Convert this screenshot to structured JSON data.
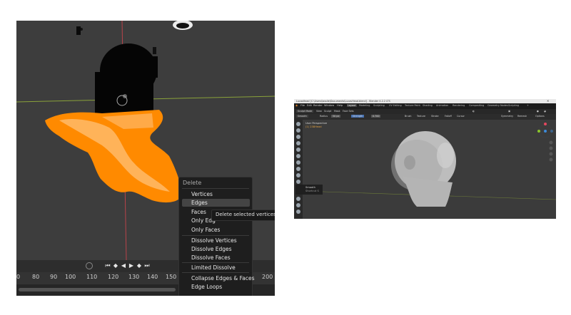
{
  "left_viewport": {
    "timeline_frames": [
      "0",
      "80",
      "90",
      "100",
      "110",
      "120",
      "130",
      "140",
      "150",
      "200"
    ],
    "context_menu": {
      "title": "Delete",
      "items": [
        "Vertices",
        "Edges",
        "Faces",
        "Only Edg",
        "Only Faces",
        "Dissolve Vertices",
        "Dissolve Edges",
        "Dissolve Faces",
        "Limited Dissolve",
        "Collapse Edges & Faces",
        "Edge Loops"
      ],
      "highlighted": "Edges"
    },
    "tooltip": "Delete selected vertices, ec",
    "colors": {
      "selection": "#ff8a00",
      "viewport_bg": "#3d3d3d",
      "menu_bg": "#1e1e1e"
    }
  },
  "right_window": {
    "title": "LucasHead [C:\\Users\\lassile\\Documents\\LucasHead.blend] - Blender 4.2.2 LTS",
    "menus": [
      "File",
      "Edit",
      "Render",
      "Window",
      "Help"
    ],
    "workspaces": [
      "Layout",
      "Modeling",
      "Sculpting",
      "UV Editing",
      "Texture Paint",
      "Shading",
      "Animation",
      "Rendering",
      "Compositing",
      "Geometry Nodes",
      "Scripting"
    ],
    "header": {
      "mode": "Sculpt Mode",
      "view": "View",
      "sculpt": "Sculpt",
      "mask": "Mask",
      "face_sets": "Face Sets"
    },
    "tool_settings": {
      "brush": "Smooth",
      "radius_label": "Radius",
      "radius_value": "50 px",
      "strength_label": "Strength",
      "strength_value": "0.700",
      "brush_menu": "Brush",
      "texture_menu": "Texture",
      "stroke_menu": "Stroke",
      "falloff_menu": "Falloff",
      "cursor_menu": "Cursor"
    },
    "overlay_text": {
      "view_name": "User Perspective",
      "object_name": "(1) 238Head"
    },
    "right_header": {
      "orientation": "Default",
      "symmetry_label": "Symmetry",
      "remesh": "Remesh",
      "options": "Options"
    },
    "brush_popup": {
      "name": "Smooth",
      "subtitle": "Shortcut S"
    },
    "colors": {
      "accent": "#4772b3",
      "axis_x": "#e5485f",
      "axis_y": "#8ac52b",
      "axis_z": "#3d8bd9"
    }
  }
}
